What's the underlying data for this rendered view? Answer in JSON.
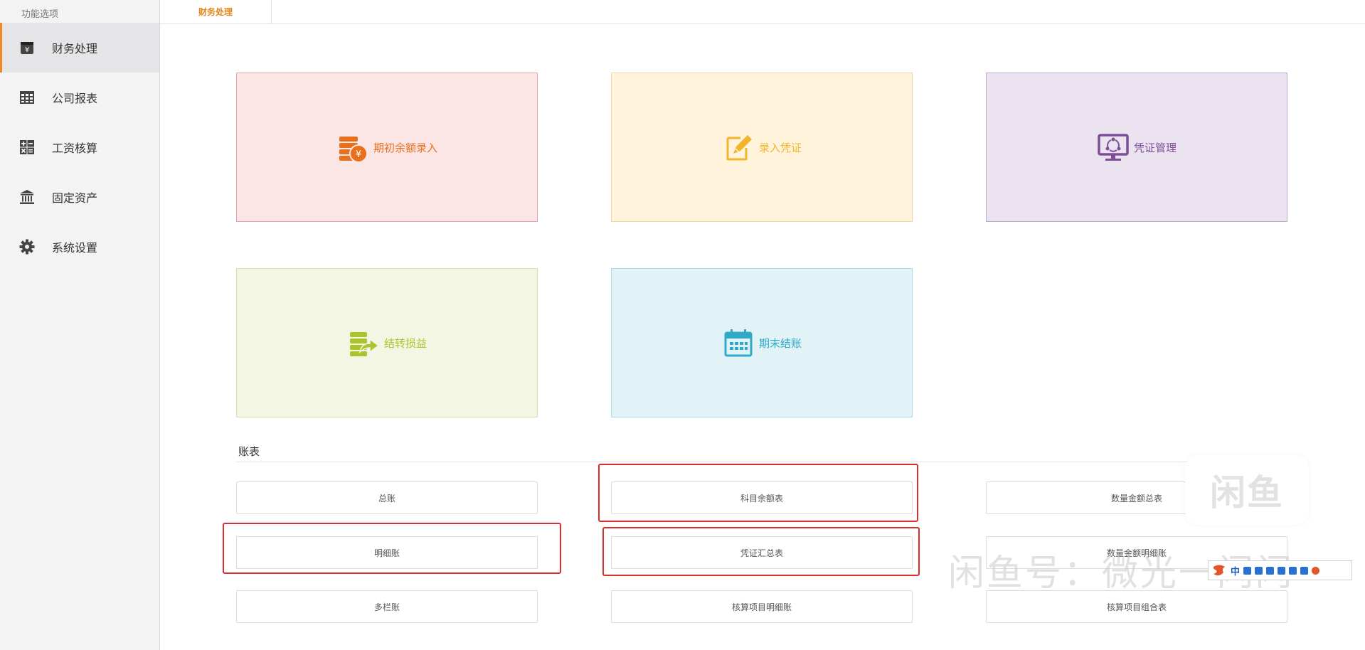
{
  "sidebar": {
    "title": "功能选项",
    "items": [
      {
        "label": "财务处理",
        "icon": "yen-wallet-icon",
        "active": true
      },
      {
        "label": "公司报表",
        "icon": "table-grid-icon"
      },
      {
        "label": "工资核算",
        "icon": "calculator-icon"
      },
      {
        "label": "固定资产",
        "icon": "bank-building-icon"
      },
      {
        "label": "系统设置",
        "icon": "gear-icon"
      }
    ]
  },
  "tabs": [
    {
      "label": "财务处理",
      "active": true
    }
  ],
  "cards": [
    {
      "label": "期初余额录入",
      "icon": "coin-stack-yen-icon",
      "color": "#e8701c"
    },
    {
      "label": "录入凭证",
      "icon": "edit-document-icon",
      "color": "#f2b42a"
    },
    {
      "label": "凭证管理",
      "icon": "monitor-cycle-icon",
      "color": "#7d4d96"
    },
    {
      "label": "结转损益",
      "icon": "coin-stack-arrow-icon",
      "color": "#a9c42c"
    },
    {
      "label": "期末结账",
      "icon": "calendar-icon",
      "color": "#31a9c9"
    }
  ],
  "reports": {
    "title": "账表",
    "buttons": [
      [
        "总账",
        "科目余额表",
        "数量金额总表"
      ],
      [
        "明细账",
        "凭证汇总表",
        "数量金额明细账"
      ],
      [
        "多栏账",
        "核算项目明细账",
        "核算项目组合表"
      ]
    ]
  },
  "overlay": {
    "watermark_badge": "闲鱼",
    "watermark_text": "闲鱼号：微光一闪闪",
    "ime_label": "中"
  }
}
